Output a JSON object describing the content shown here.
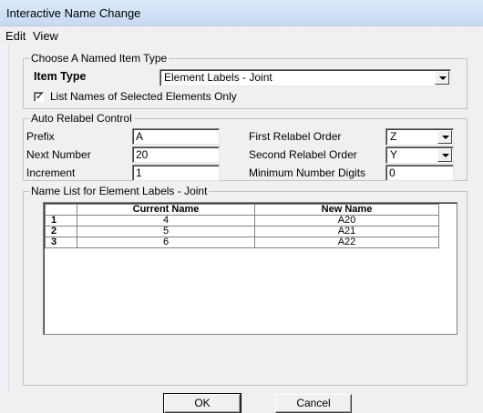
{
  "window": {
    "title": "Interactive Name Change"
  },
  "menu": {
    "edit": "Edit",
    "view": "View"
  },
  "named_item": {
    "legend": "Choose A Named Item Type",
    "item_type_label": "Item Type",
    "item_type_value": "Element Labels - Joint",
    "checkbox_label": "List Names of Selected Elements Only",
    "checkbox_checked": true
  },
  "relabel": {
    "legend": "Auto Relabel Control",
    "prefix_label": "Prefix",
    "prefix_value": "A",
    "next_number_label": "Next Number",
    "next_number_value": "20",
    "increment_label": "Increment",
    "increment_value": "1",
    "first_order_label": "First Relabel Order",
    "first_order_value": "Z",
    "second_order_label": "Second Relabel Order",
    "second_order_value": "Y",
    "min_digits_label": "Minimum Number Digits",
    "min_digits_value": "0"
  },
  "name_list": {
    "legend": "Name List for Element Labels - Joint",
    "col_current": "Current Name",
    "col_new": "New Name",
    "rows": [
      {
        "num": "1",
        "current": "4",
        "new": "A20"
      },
      {
        "num": "2",
        "current": "5",
        "new": "A21"
      },
      {
        "num": "3",
        "current": "6",
        "new": "A22"
      }
    ]
  },
  "buttons": {
    "ok": "OK",
    "cancel": "Cancel"
  }
}
